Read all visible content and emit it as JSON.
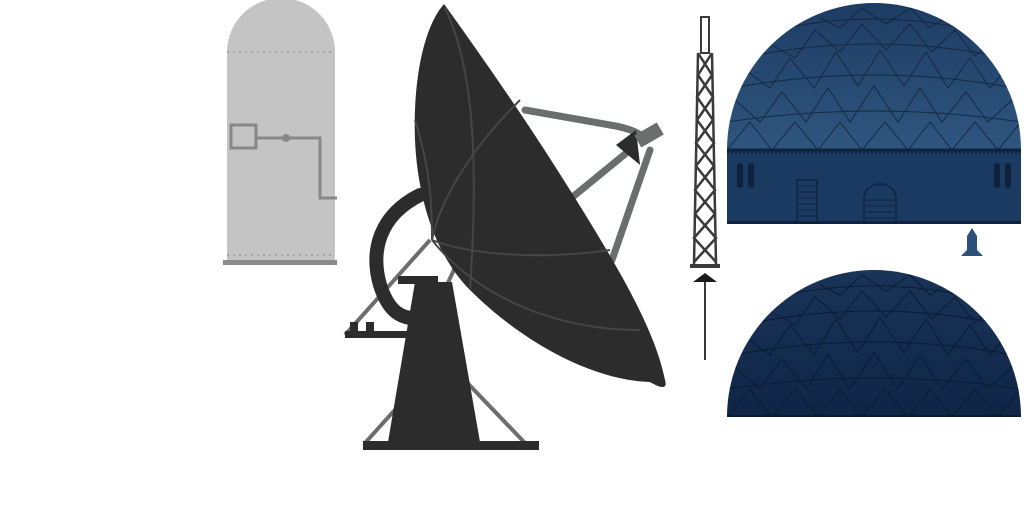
{
  "scene": {
    "items": [
      {
        "name": "silo-tank",
        "icon": "silo-icon"
      },
      {
        "name": "radio-telescope-dish",
        "icon": "satellite-dish-icon"
      },
      {
        "name": "lattice-antenna-tower",
        "icon": "antenna-tower-icon"
      },
      {
        "name": "observatory-dome-with-base",
        "icon": "dome-building-icon"
      },
      {
        "name": "small-rocket-marker",
        "icon": "rocket-icon"
      },
      {
        "name": "observatory-dome",
        "icon": "dome-icon"
      }
    ]
  },
  "colors": {
    "background": "#ffffff",
    "silo_body": "#c4c4c4",
    "silo_outline": "#878787",
    "dish_dark": "#2b2c2b",
    "dish_support": "#6b6e6c",
    "tower": "#3a3a3a",
    "dome_light": "#2d5078",
    "dome_dark": "#152f55",
    "dome_lines": "#13233a"
  }
}
